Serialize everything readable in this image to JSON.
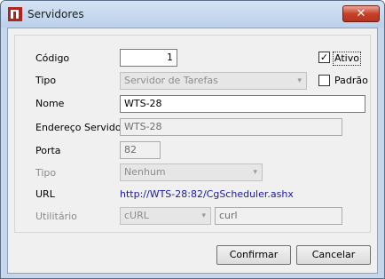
{
  "window": {
    "title": "Servidores",
    "close_label": "✕"
  },
  "form": {
    "codigo_label": "Código",
    "codigo_value": "1",
    "ativo_label": "Ativo",
    "ativo_checked": "✓",
    "tipo_label": "Tipo",
    "tipo_value": "Servidor de Tarefas",
    "padrao_label": "Padrão",
    "nome_label": "Nome",
    "nome_value": "WTS-28",
    "endereco_label": "Endereço Servidor",
    "endereco_value": "WTS-28",
    "porta_label": "Porta",
    "porta_value": "82",
    "tipo2_label": "Tipo",
    "tipo2_value": "Nenhum",
    "url_label": "URL",
    "url_value": "http://WTS-28:82/CgScheduler.ashx",
    "utilitario_label": "Utilitário",
    "utilitario_value": "cURL",
    "utilitario_cmd": "curl"
  },
  "buttons": {
    "confirmar": "Confirmar",
    "cancelar": "Cancelar"
  },
  "icons": {
    "combo_arrow": "▾"
  },
  "colors": {
    "link": "#1a1aa6",
    "close_button": "#c8412a",
    "title_bar": "#c6d6eb"
  }
}
